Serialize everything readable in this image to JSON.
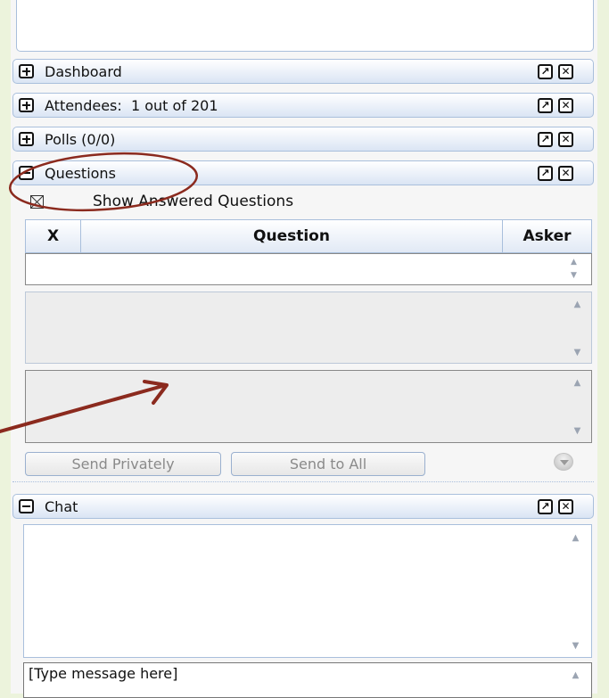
{
  "panels": {
    "dashboard": {
      "label": "Dashboard"
    },
    "attendees": {
      "label": "Attendees:  1 out of 201"
    },
    "polls": {
      "label": "Polls (0/0)"
    },
    "questions": {
      "label": "Questions",
      "show_answered": "Show Answered Questions",
      "columns": [
        "X",
        "Question",
        "Asker"
      ],
      "send_privately": "Send Privately",
      "send_to_all": "Send to All"
    },
    "chat": {
      "label": "Chat",
      "input_value": "[Type message here]"
    }
  },
  "icons": {
    "expand": "plus-box-icon",
    "collapse": "minus-box-icon",
    "popout": "popout-icon",
    "close": "close-icon",
    "checkbox": "x-checkbox-icon",
    "scroll_up": "triangle-up-icon",
    "scroll_down": "triangle-down-icon",
    "dropdown": "circle-arrow-down-icon"
  },
  "colors": {
    "page_background": "#ecf3dc",
    "header_border": "#a9bfdc",
    "header_gradient_bottom": "#dae5f4",
    "annotation": "#8b2a1e"
  }
}
